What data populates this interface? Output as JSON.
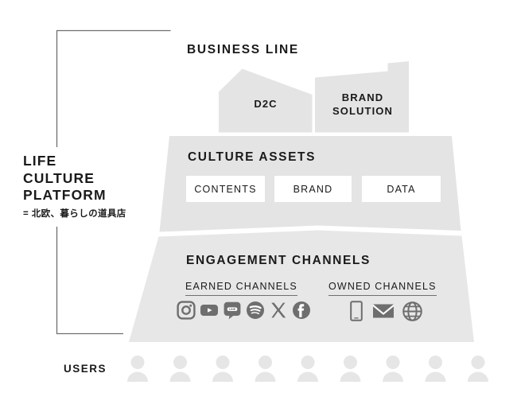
{
  "diagram": {
    "platform": {
      "lines": [
        "LIFE",
        "CULTURE",
        "PLATFORM"
      ],
      "subtitle": "= 北欧、暮らしの道具店"
    },
    "business_line": {
      "title": "BUSINESS LINE",
      "shapes": [
        {
          "label": "D2C",
          "name": "d2c-shape"
        },
        {
          "label": "BRAND\nSOLUTION",
          "label_line1": "BRAND",
          "label_line2": "SOLUTION",
          "name": "brand-solution-shape"
        }
      ]
    },
    "culture_assets": {
      "title": "CULTURE ASSETS",
      "items": [
        {
          "label": "CONTENTS"
        },
        {
          "label": "BRAND"
        },
        {
          "label": "DATA"
        }
      ]
    },
    "engagement_channels": {
      "title": "ENGAGEMENT CHANNELS",
      "earned": {
        "label": "EARNED CHANNELS",
        "icons": [
          "instagram-icon",
          "youtube-icon",
          "line-icon",
          "spotify-icon",
          "x-twitter-icon",
          "facebook-icon"
        ]
      },
      "owned": {
        "label": "OWNED CHANNELS",
        "icons": [
          "mobile-phone-icon",
          "email-icon",
          "globe-icon"
        ]
      }
    },
    "users": {
      "label": "USERS",
      "count": 9
    },
    "colors": {
      "shape_fill": "#e4e4e4",
      "shape_fill_light": "#e7e7e7",
      "icon_gray": "#6e6e6e",
      "user_gray": "#e6e6e6",
      "text": "#1a1a1a",
      "bracket": "#6f6f6f",
      "background": "#ffffff"
    }
  }
}
